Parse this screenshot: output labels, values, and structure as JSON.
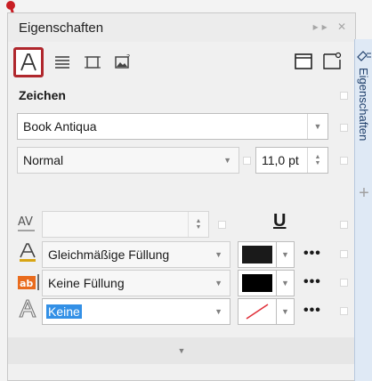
{
  "panel": {
    "title": "Eigenschaften",
    "titlebar_controls": "▸▸ ✕"
  },
  "toolbar": {
    "tabs": [
      {
        "name": "Zeichen",
        "icon": "character-a-icon",
        "selected": true
      },
      {
        "name": "Absatz",
        "icon": "paragraph-lines-icon",
        "selected": false
      },
      {
        "name": "Rahmen",
        "icon": "frame-icon",
        "selected": false
      },
      {
        "name": "Bild",
        "icon": "image-icon",
        "selected": false
      }
    ],
    "right_icons": [
      "frame-window-icon",
      "frame-tooltip-icon"
    ]
  },
  "section": {
    "title": "Zeichen"
  },
  "font": {
    "family": "Book Antiqua",
    "style": "Normal",
    "size": "11,0 pt"
  },
  "fills": {
    "text_fill": {
      "label": "Gleichmäßige Füllung",
      "color": "#1a1a1a"
    },
    "background_fill": {
      "label": "Keine Füllung",
      "color": "#000000"
    },
    "outline": {
      "label": "Keine",
      "selected_text": true
    }
  },
  "underline_icon": "U",
  "more_label": "•••",
  "side_tab": {
    "label": "Eigenschaften",
    "plus": "+"
  },
  "colors": {
    "accent_red": "#b0272d",
    "selection_blue": "#3390e6",
    "panel_bg": "#f0f0f0"
  }
}
